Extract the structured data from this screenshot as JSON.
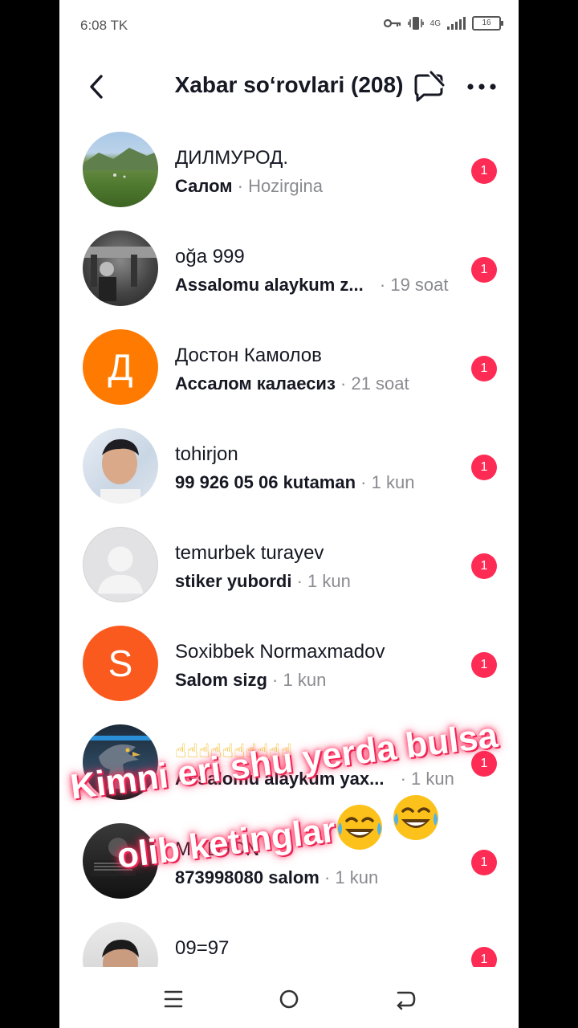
{
  "status": {
    "time": "6:08 TK",
    "network": "4G",
    "battery": "16"
  },
  "header": {
    "title": "Xabar so‘rovlari (208)"
  },
  "items": [
    {
      "name": "ДИЛМУРОД.",
      "preview": "Салом",
      "time": "· Hozirgina",
      "badge": "1",
      "avatar_letter": ""
    },
    {
      "name": "oğa 999",
      "preview": "Assalomu alaykum z...",
      "time": "· 19 soat",
      "badge": "1",
      "avatar_letter": ""
    },
    {
      "name": "Достон Камолов",
      "preview": "Ассалом калаесиз",
      "time": "· 21 soat",
      "badge": "1",
      "avatar_letter": "Д"
    },
    {
      "name": "tohirjon",
      "preview": "99 926 05 06 kutaman",
      "time": "· 1 kun",
      "badge": "1",
      "avatar_letter": ""
    },
    {
      "name": "temurbek turayev",
      "preview": "stiker yubordi",
      "time": "· 1 kun",
      "badge": "1",
      "avatar_letter": ""
    },
    {
      "name": "Soxibbek Normaxmadov",
      "preview": "Salom sizg",
      "time": "· 1 kun",
      "badge": "1",
      "avatar_letter": "S"
    },
    {
      "name": "☝☝☝☝☝☝☝☝☝☝",
      "preview": "Assalomu alaykum yax...",
      "time": "· 1 kun",
      "badge": "1",
      "avatar_letter": ""
    },
    {
      "name": "M...DJON",
      "preview": "873998080 salom",
      "time": "· 1 kun",
      "badge": "1",
      "avatar_letter": ""
    },
    {
      "name": "09=97",
      "preview": "",
      "time": "",
      "badge": "1",
      "avatar_letter": ""
    }
  ],
  "overlay": {
    "line1": "Kimni eri shu yerda bulsa",
    "line2": "olib ketinglar"
  },
  "colors": {
    "accent": "#fe2c55",
    "orange_avatar": "#ff7a00",
    "orange_avatar_2": "#fb5a1e"
  },
  "icons": {
    "back": "chevron-left-icon",
    "compose_off": "message-off-icon",
    "more": "more-horizontal-icon",
    "nav_menu": "menu-icon",
    "nav_home": "circle-home-icon",
    "nav_back": "back-arrow-icon"
  }
}
